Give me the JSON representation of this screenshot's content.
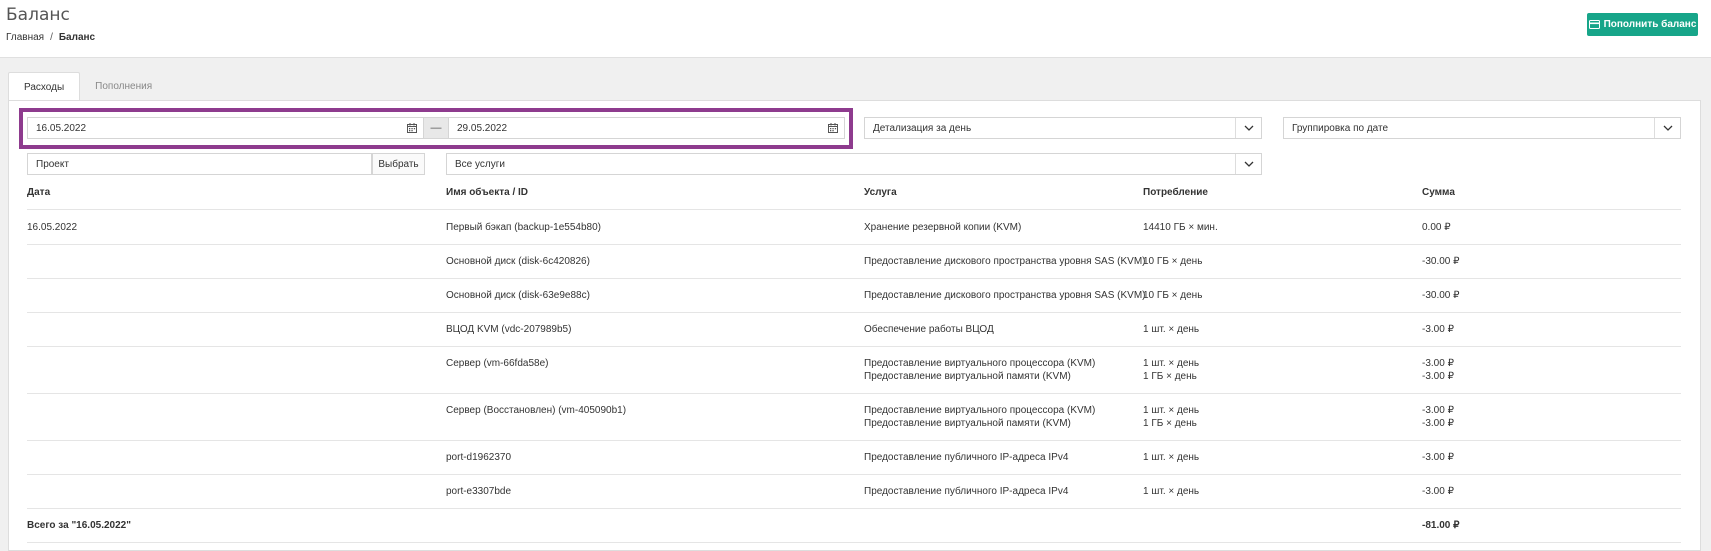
{
  "header": {
    "title": "Баланс",
    "breadcrumb": {
      "home": "Главная",
      "separator": "/",
      "current": "Баланс"
    },
    "topup_button": "Пополнить баланс",
    "accent_color": "#17a589"
  },
  "tabs": [
    {
      "label": "Расходы",
      "active": true
    },
    {
      "label": "Пополнения",
      "active": false
    }
  ],
  "filters": {
    "date_from": "16.05.2022",
    "date_separator": "—",
    "date_to": "29.05.2022",
    "detail": "Детализация за день",
    "grouping": "Группировка по дате",
    "project_placeholder": "Проект",
    "select_button": "Выбрать",
    "services": "Все услуги",
    "highlight_color": "#8e3b8e"
  },
  "table": {
    "headers": [
      "Дата",
      "Имя объекта / ID",
      "Услуга",
      "Потребление",
      "Сумма"
    ],
    "date": "16.05.2022",
    "rows": [
      {
        "object": "Первый бэкап (backup-1e554b80)",
        "service": [
          "Хранение резервной копии (KVM)"
        ],
        "usage": [
          "14410 ГБ × мин."
        ],
        "amount": [
          "0.00 ₽"
        ]
      },
      {
        "object": "Основной диск (disk-6c420826)",
        "service": [
          "Предоставление дискового пространства уровня SAS (KVM)"
        ],
        "usage": [
          "10 ГБ × день"
        ],
        "amount": [
          "-30.00 ₽"
        ]
      },
      {
        "object": "Основной диск (disk-63e9e88c)",
        "service": [
          "Предоставление дискового пространства уровня SAS (KVM)"
        ],
        "usage": [
          "10 ГБ × день"
        ],
        "amount": [
          "-30.00 ₽"
        ]
      },
      {
        "object": "ВЦОД KVM (vdc-207989b5)",
        "service": [
          "Обеспечение работы ВЦОД"
        ],
        "usage": [
          "1 шт. × день"
        ],
        "amount": [
          "-3.00 ₽"
        ]
      },
      {
        "object": "Сервер (vm-66fda58e)",
        "service": [
          "Предоставление виртуального процессора (KVM)",
          "Предоставление виртуальной памяти (KVM)"
        ],
        "usage": [
          "1 шт. × день",
          "1 ГБ × день"
        ],
        "amount": [
          "-3.00 ₽",
          "-3.00 ₽"
        ]
      },
      {
        "object": "Сервер (Восстановлен) (vm-405090b1)",
        "service": [
          "Предоставление виртуального процессора (KVM)",
          "Предоставление виртуальной памяти (KVM)"
        ],
        "usage": [
          "1 шт. × день",
          "1 ГБ × день"
        ],
        "amount": [
          "-3.00 ₽",
          "-3.00 ₽"
        ]
      },
      {
        "object": "port-d1962370",
        "service": [
          "Предоставление публичного IP-адреса IPv4"
        ],
        "usage": [
          "1 шт. × день"
        ],
        "amount": [
          "-3.00 ₽"
        ]
      },
      {
        "object": "port-e3307bde",
        "service": [
          "Предоставление публичного IP-адреса IPv4"
        ],
        "usage": [
          "1 шт. × день"
        ],
        "amount": [
          "-3.00 ₽"
        ]
      }
    ],
    "total_label": "Всего за \"16.05.2022\"",
    "total_amount": "-81.00 ₽"
  }
}
